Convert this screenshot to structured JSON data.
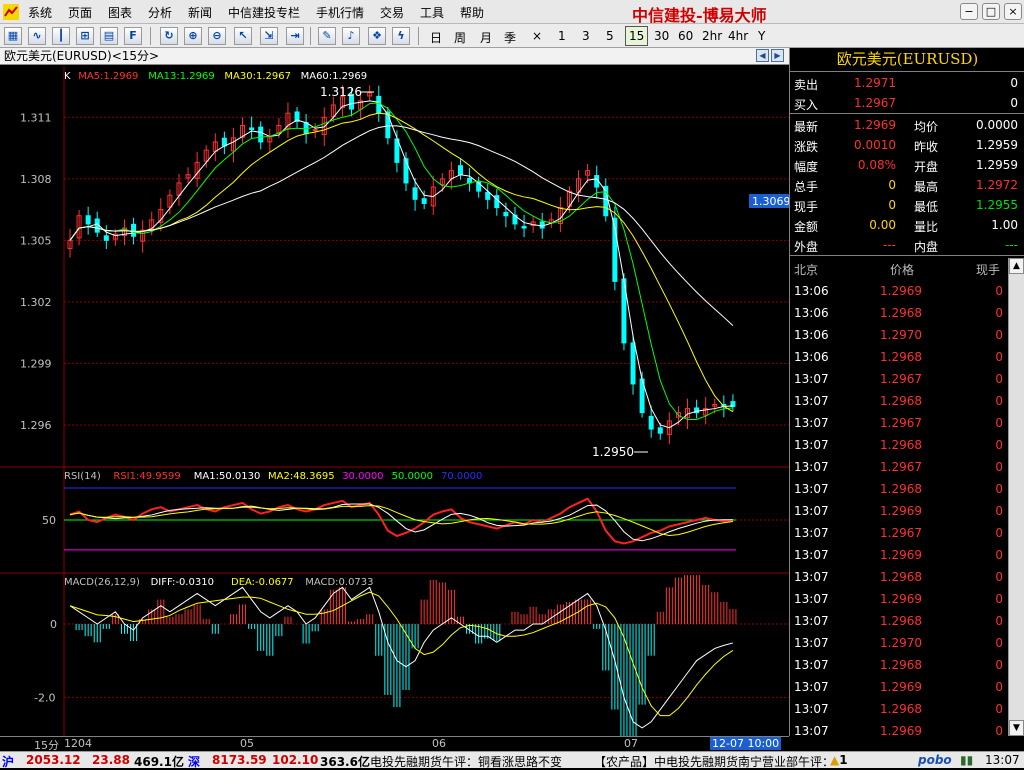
{
  "menubar": {
    "items": [
      "系统",
      "页面",
      "图表",
      "分析",
      "新闻",
      "中信建投专栏",
      "手机行情",
      "交易",
      "工具",
      "帮助"
    ],
    "brand": "中信建投-博易大师"
  },
  "toolbar": {
    "periods": [
      "日",
      "周",
      "月",
      "季",
      "×",
      "1",
      "3",
      "5",
      "15",
      "30",
      "60",
      "2hr",
      "4hr",
      "Y"
    ],
    "selected_period": "15"
  },
  "chart": {
    "title": "欧元美元(EURUSD)<15分>",
    "ma_legend": {
      "k": "K",
      "ma5": "MA5:1.2969",
      "ma13": "MA13:1.2969",
      "ma30": "MA30:1.2967",
      "ma60": "MA60:1.2969"
    },
    "rsi_legend": {
      "name": "RSI(14)",
      "rsi1": "RSI1:49.9599",
      "ma1": "MA1:50.0130",
      "ma2": "MA2:48.3695",
      "l30": "30.0000",
      "l50": "50.0000",
      "l70": "70.0000"
    },
    "macd_legend": {
      "name": "MACD(26,12,9)",
      "diff": "DIFF:-0.0310",
      "dea": "DEA:-0.0677",
      "macd": "MACD:0.0733"
    },
    "high_label": "1.3126",
    "low_label": "1.2950",
    "price_marker": "1.3069",
    "y_ticks": [
      "1.311",
      "1.308",
      "1.305",
      "1.302",
      "1.299",
      "1.296"
    ],
    "rsi_tick": "50",
    "macd_ticks": [
      "0",
      "-2.0"
    ],
    "x_ticks": [
      "1204",
      "05",
      "06",
      "07"
    ],
    "period_label": "15分",
    "cursor_time": "12-07 10:00"
  },
  "colors": {
    "up": "#ff3030",
    "down": "#00ffff",
    "ma5": "#ffffff",
    "ma13": "#00ff00",
    "ma30": "#ffff00",
    "ma60": "#ffffff",
    "grid": "#8b0000"
  },
  "chart_data": {
    "type": "candlestick",
    "symbol": "EURUSD",
    "interval": "15分",
    "x_ticks": [
      "1204",
      "05",
      "06",
      "07"
    ],
    "ylim": [
      1.294,
      1.3135
    ],
    "high": 1.3126,
    "low": 1.295,
    "last": 1.2969,
    "close_series": [
      1.305,
      1.3062,
      1.3058,
      1.3054,
      1.305,
      1.3053,
      1.3056,
      1.3052,
      1.3055,
      1.306,
      1.3065,
      1.3072,
      1.3078,
      1.3082,
      1.3088,
      1.3094,
      1.3098,
      1.3096,
      1.31,
      1.3106,
      1.3104,
      1.3098,
      1.31,
      1.3106,
      1.3112,
      1.3108,
      1.3102,
      1.3104,
      1.311,
      1.3116,
      1.312,
      1.3114,
      1.3118,
      1.3122,
      1.3112,
      1.31,
      1.3088,
      1.3078,
      1.307,
      1.3068,
      1.3076,
      1.308,
      1.3084,
      1.3082,
      1.3078,
      1.3074,
      1.307,
      1.3066,
      1.3062,
      1.3058,
      1.3056,
      1.3059,
      1.3056,
      1.306,
      1.3066,
      1.3074,
      1.308,
      1.3084,
      1.3076,
      1.3062,
      1.303,
      1.3,
      1.298,
      1.2966,
      1.2958,
      1.2956,
      1.2962,
      1.2966,
      1.2968,
      1.2966,
      1.2968,
      1.297,
      1.2969,
      1.2969
    ],
    "rsi1": [
      55,
      58,
      50,
      48,
      52,
      55,
      53,
      50,
      56,
      60,
      62,
      58,
      60,
      62,
      64,
      60,
      58,
      62,
      64,
      66,
      60,
      56,
      58,
      62,
      64,
      60,
      58,
      60,
      64,
      66,
      68,
      62,
      64,
      66,
      55,
      40,
      35,
      38,
      42,
      48,
      55,
      58,
      60,
      52,
      48,
      46,
      44,
      42,
      45,
      48,
      46,
      50,
      48,
      52,
      56,
      62,
      66,
      70,
      58,
      40,
      30,
      28,
      30,
      34,
      38,
      40,
      44,
      46,
      48,
      50,
      52,
      50,
      49,
      50
    ],
    "macd_diff": [
      0.03,
      0.02,
      0.01,
      0.0,
      0.01,
      0.02,
      0.0,
      -0.01,
      0.01,
      0.02,
      0.03,
      0.02,
      0.03,
      0.04,
      0.05,
      0.04,
      0.03,
      0.04,
      0.05,
      0.06,
      0.04,
      0.02,
      0.01,
      0.02,
      0.03,
      0.02,
      0.0,
      0.01,
      0.03,
      0.05,
      0.06,
      0.04,
      0.05,
      0.06,
      0.02,
      -0.03,
      -0.06,
      -0.07,
      -0.06,
      -0.03,
      -0.01,
      0.0,
      0.01,
      0.0,
      -0.01,
      -0.02,
      -0.02,
      -0.03,
      -0.02,
      -0.01,
      -0.01,
      0.0,
      0.0,
      0.01,
      0.02,
      0.03,
      0.04,
      0.05,
      0.03,
      -0.01,
      -0.06,
      -0.12,
      -0.16,
      -0.17,
      -0.16,
      -0.14,
      -0.12,
      -0.1,
      -0.08,
      -0.06,
      -0.05,
      -0.04,
      -0.035,
      -0.031
    ]
  },
  "quote": {
    "title": "欧元美元(EURUSD)",
    "rows": [
      {
        "l1": "卖出",
        "v1": "1.2971",
        "c1": "red",
        "l2": "",
        "v2": "0",
        "c2": "white"
      },
      {
        "l1": "买入",
        "v1": "1.2967",
        "c1": "red",
        "l2": "",
        "v2": "0",
        "c2": "white"
      },
      {
        "l1": "最新",
        "v1": "1.2969",
        "c1": "red",
        "l2": "均价",
        "v2": "0.0000",
        "c2": "white"
      },
      {
        "l1": "涨跌",
        "v1": "0.0010",
        "c1": "red",
        "l2": "昨收",
        "v2": "1.2959",
        "c2": "white"
      },
      {
        "l1": "幅度",
        "v1": "0.08%",
        "c1": "red",
        "l2": "开盘",
        "v2": "1.2959",
        "c2": "white"
      },
      {
        "l1": "总手",
        "v1": "0",
        "c1": "yellow",
        "l2": "最高",
        "v2": "1.2972",
        "c2": "red"
      },
      {
        "l1": "现手",
        "v1": "0",
        "c1": "yellow",
        "l2": "最低",
        "v2": "1.2955",
        "c2": "green"
      },
      {
        "l1": "金额",
        "v1": "0.00",
        "c1": "yellow",
        "l2": "量比",
        "v2": "1.00",
        "c2": "white"
      },
      {
        "l1": "外盘",
        "v1": "---",
        "c1": "red",
        "l2": "内盘",
        "v2": "---",
        "c2": "green"
      }
    ],
    "tick_header": {
      "time": "北京",
      "price": "价格",
      "vol": "现手"
    },
    "ticks": [
      {
        "time": "13:06",
        "price": "1.2969",
        "vol": "0"
      },
      {
        "time": "13:06",
        "price": "1.2968",
        "vol": "0"
      },
      {
        "time": "13:06",
        "price": "1.2970",
        "vol": "0"
      },
      {
        "time": "13:06",
        "price": "1.2968",
        "vol": "0"
      },
      {
        "time": "13:07",
        "price": "1.2967",
        "vol": "0"
      },
      {
        "time": "13:07",
        "price": "1.2968",
        "vol": "0"
      },
      {
        "time": "13:07",
        "price": "1.2967",
        "vol": "0"
      },
      {
        "time": "13:07",
        "price": "1.2968",
        "vol": "0"
      },
      {
        "time": "13:07",
        "price": "1.2967",
        "vol": "0"
      },
      {
        "time": "13:07",
        "price": "1.2968",
        "vol": "0"
      },
      {
        "time": "13:07",
        "price": "1.2969",
        "vol": "0"
      },
      {
        "time": "13:07",
        "price": "1.2967",
        "vol": "0"
      },
      {
        "time": "13:07",
        "price": "1.2969",
        "vol": "0"
      },
      {
        "time": "13:07",
        "price": "1.2968",
        "vol": "0"
      },
      {
        "time": "13:07",
        "price": "1.2969",
        "vol": "0"
      },
      {
        "time": "13:07",
        "price": "1.2968",
        "vol": "0"
      },
      {
        "time": "13:07",
        "price": "1.2970",
        "vol": "0"
      },
      {
        "time": "13:07",
        "price": "1.2968",
        "vol": "0"
      },
      {
        "time": "13:07",
        "price": "1.2969",
        "vol": "0"
      },
      {
        "time": "13:07",
        "price": "1.2968",
        "vol": "0"
      },
      {
        "time": "13:07",
        "price": "1.2969",
        "vol": "0"
      }
    ]
  },
  "statusbar": {
    "sh_label": "沪",
    "sh_index": "2053.12",
    "sh_change": "23.88",
    "sh_amount": "469.1亿",
    "sz_label": "深",
    "sz_index": "8173.59",
    "sz_change": "102.10",
    "sz_amount": "363.6亿",
    "news1": "电投先融期货午评：铜看涨思路不变",
    "news2": "【农产品】中电投先融期货南宁营业部午评：",
    "alert_count": "1",
    "pobo": "pobo",
    "clock": "13:07"
  }
}
